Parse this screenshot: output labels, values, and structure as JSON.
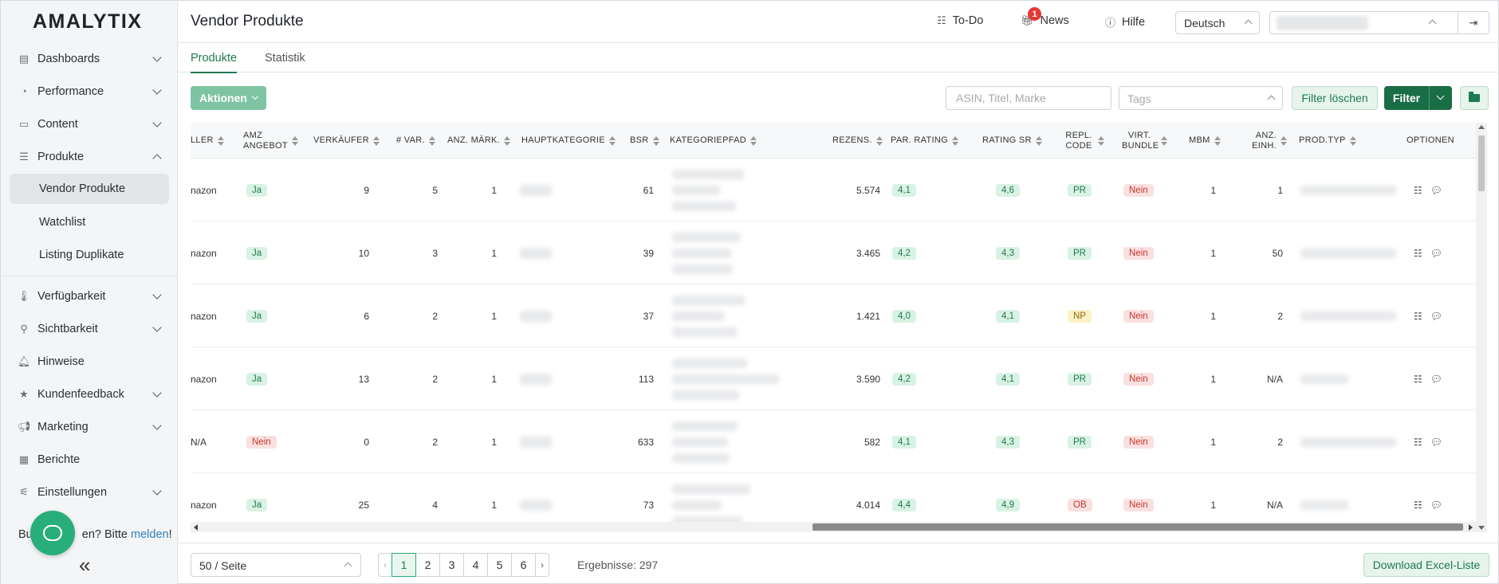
{
  "sidebar": {
    "logo": "AMALYTIX",
    "items": [
      {
        "label": "Dashboards",
        "icon": "stack-icon",
        "chevron": "down"
      },
      {
        "label": "Performance",
        "icon": "gauge-icon",
        "chevron": "down"
      },
      {
        "label": "Content",
        "icon": "card-icon",
        "chevron": "down"
      },
      {
        "label": "Produkte",
        "icon": "list-icon",
        "chevron": "up"
      },
      {
        "label": "Verfügbarkeit",
        "icon": "thermometer-icon",
        "chevron": "down"
      },
      {
        "label": "Sichtbarkeit",
        "icon": "search-icon",
        "chevron": "down"
      },
      {
        "label": "Hinweise",
        "icon": "bell-icon",
        "chevron": ""
      },
      {
        "label": "Kundenfeedback",
        "icon": "star-icon",
        "chevron": "down"
      },
      {
        "label": "Marketing",
        "icon": "megaphone-icon",
        "chevron": "down"
      },
      {
        "label": "Berichte",
        "icon": "table-icon",
        "chevron": ""
      },
      {
        "label": "Einstellungen",
        "icon": "sliders-icon",
        "chevron": "down"
      }
    ],
    "sub_items": [
      "Vendor Produkte",
      "Watchlist",
      "Listing Duplikate"
    ],
    "bug_prefix": "Bu",
    "bug_middle": "en? Bitte",
    "bug_link": "melden",
    "bug_suffix": "!",
    "collapse": "«"
  },
  "header": {
    "title": "Vendor Produkte",
    "todo": "To-Do",
    "news": "News",
    "news_badge": "1",
    "help": "Hilfe",
    "language": "Deutsch"
  },
  "tabs": [
    "Produkte",
    "Statistik"
  ],
  "toolbar": {
    "actions": "Aktionen",
    "search_placeholder": "ASIN, Titel, Marke",
    "tags_placeholder": "Tags",
    "clear": "Filter löschen",
    "filter": "Filter"
  },
  "table": {
    "columns": {
      "seller": "LLER",
      "amz_offer": "AMZ ANGEBOT",
      "sellers": "VERKÄUFER",
      "variants": "# VAR.",
      "markets": "ANZ. MÄRK.",
      "main_category": "HAUPTKATEGORIE",
      "bsr": "BSR",
      "category_path": "KATEGORIEPFAD",
      "reviews": "REZENS.",
      "par_rating": "PAR. RATING",
      "rating_sr": "RATING SR",
      "repl_code": "REPL. CODE",
      "virt_bundle": "VIRT. BUNDLE",
      "mbm": "MBM",
      "units": "ANZ. EINH.",
      "prod_type": "PROD.TYP",
      "options": "OPTIONEN"
    },
    "rows": [
      {
        "seller": "nazon",
        "amz": "Ja",
        "amz_color": "green",
        "sellers": "9",
        "variants": "5",
        "markets": "1",
        "bsr": "61",
        "reviews": "5.574",
        "par_rating": "4,1",
        "rating_sr": "4,6",
        "repl": "PR",
        "repl_color": "green",
        "bundle": "Nein",
        "mbm": "1",
        "units": "1"
      },
      {
        "seller": "nazon",
        "amz": "Ja",
        "amz_color": "green",
        "sellers": "10",
        "variants": "3",
        "markets": "1",
        "bsr": "39",
        "reviews": "3.465",
        "par_rating": "4,2",
        "rating_sr": "4,3",
        "repl": "PR",
        "repl_color": "green",
        "bundle": "Nein",
        "mbm": "1",
        "units": "50"
      },
      {
        "seller": "nazon",
        "amz": "Ja",
        "amz_color": "green",
        "sellers": "6",
        "variants": "2",
        "markets": "1",
        "bsr": "37",
        "reviews": "1.421",
        "par_rating": "4,0",
        "rating_sr": "4,1",
        "repl": "NP",
        "repl_color": "yellow",
        "bundle": "Nein",
        "mbm": "1",
        "units": "2"
      },
      {
        "seller": "nazon",
        "amz": "Ja",
        "amz_color": "green",
        "sellers": "13",
        "variants": "2",
        "markets": "1",
        "bsr": "113",
        "reviews": "3.590",
        "par_rating": "4,2",
        "rating_sr": "4,1",
        "repl": "PR",
        "repl_color": "green",
        "bundle": "Nein",
        "mbm": "1",
        "units": "N/A"
      },
      {
        "seller": "N/A",
        "amz": "Nein",
        "amz_color": "red",
        "sellers": "0",
        "variants": "2",
        "markets": "1",
        "bsr": "633",
        "reviews": "582",
        "par_rating": "4,1",
        "rating_sr": "4,3",
        "repl": "PR",
        "repl_color": "green",
        "bundle": "Nein",
        "mbm": "1",
        "units": "2"
      },
      {
        "seller": "nazon",
        "amz": "Ja",
        "amz_color": "green",
        "sellers": "25",
        "variants": "4",
        "markets": "1",
        "bsr": "73",
        "reviews": "4.014",
        "par_rating": "4,4",
        "rating_sr": "4,9",
        "repl": "OB",
        "repl_color": "red",
        "bundle": "Nein",
        "mbm": "1",
        "units": "N/A"
      }
    ]
  },
  "footer": {
    "page_size": "50 / Seite",
    "pages": [
      "1",
      "2",
      "3",
      "4",
      "5",
      "6"
    ],
    "current_page": "1",
    "results": "Ergebnisse: 297",
    "excel": "Download Excel-Liste"
  }
}
